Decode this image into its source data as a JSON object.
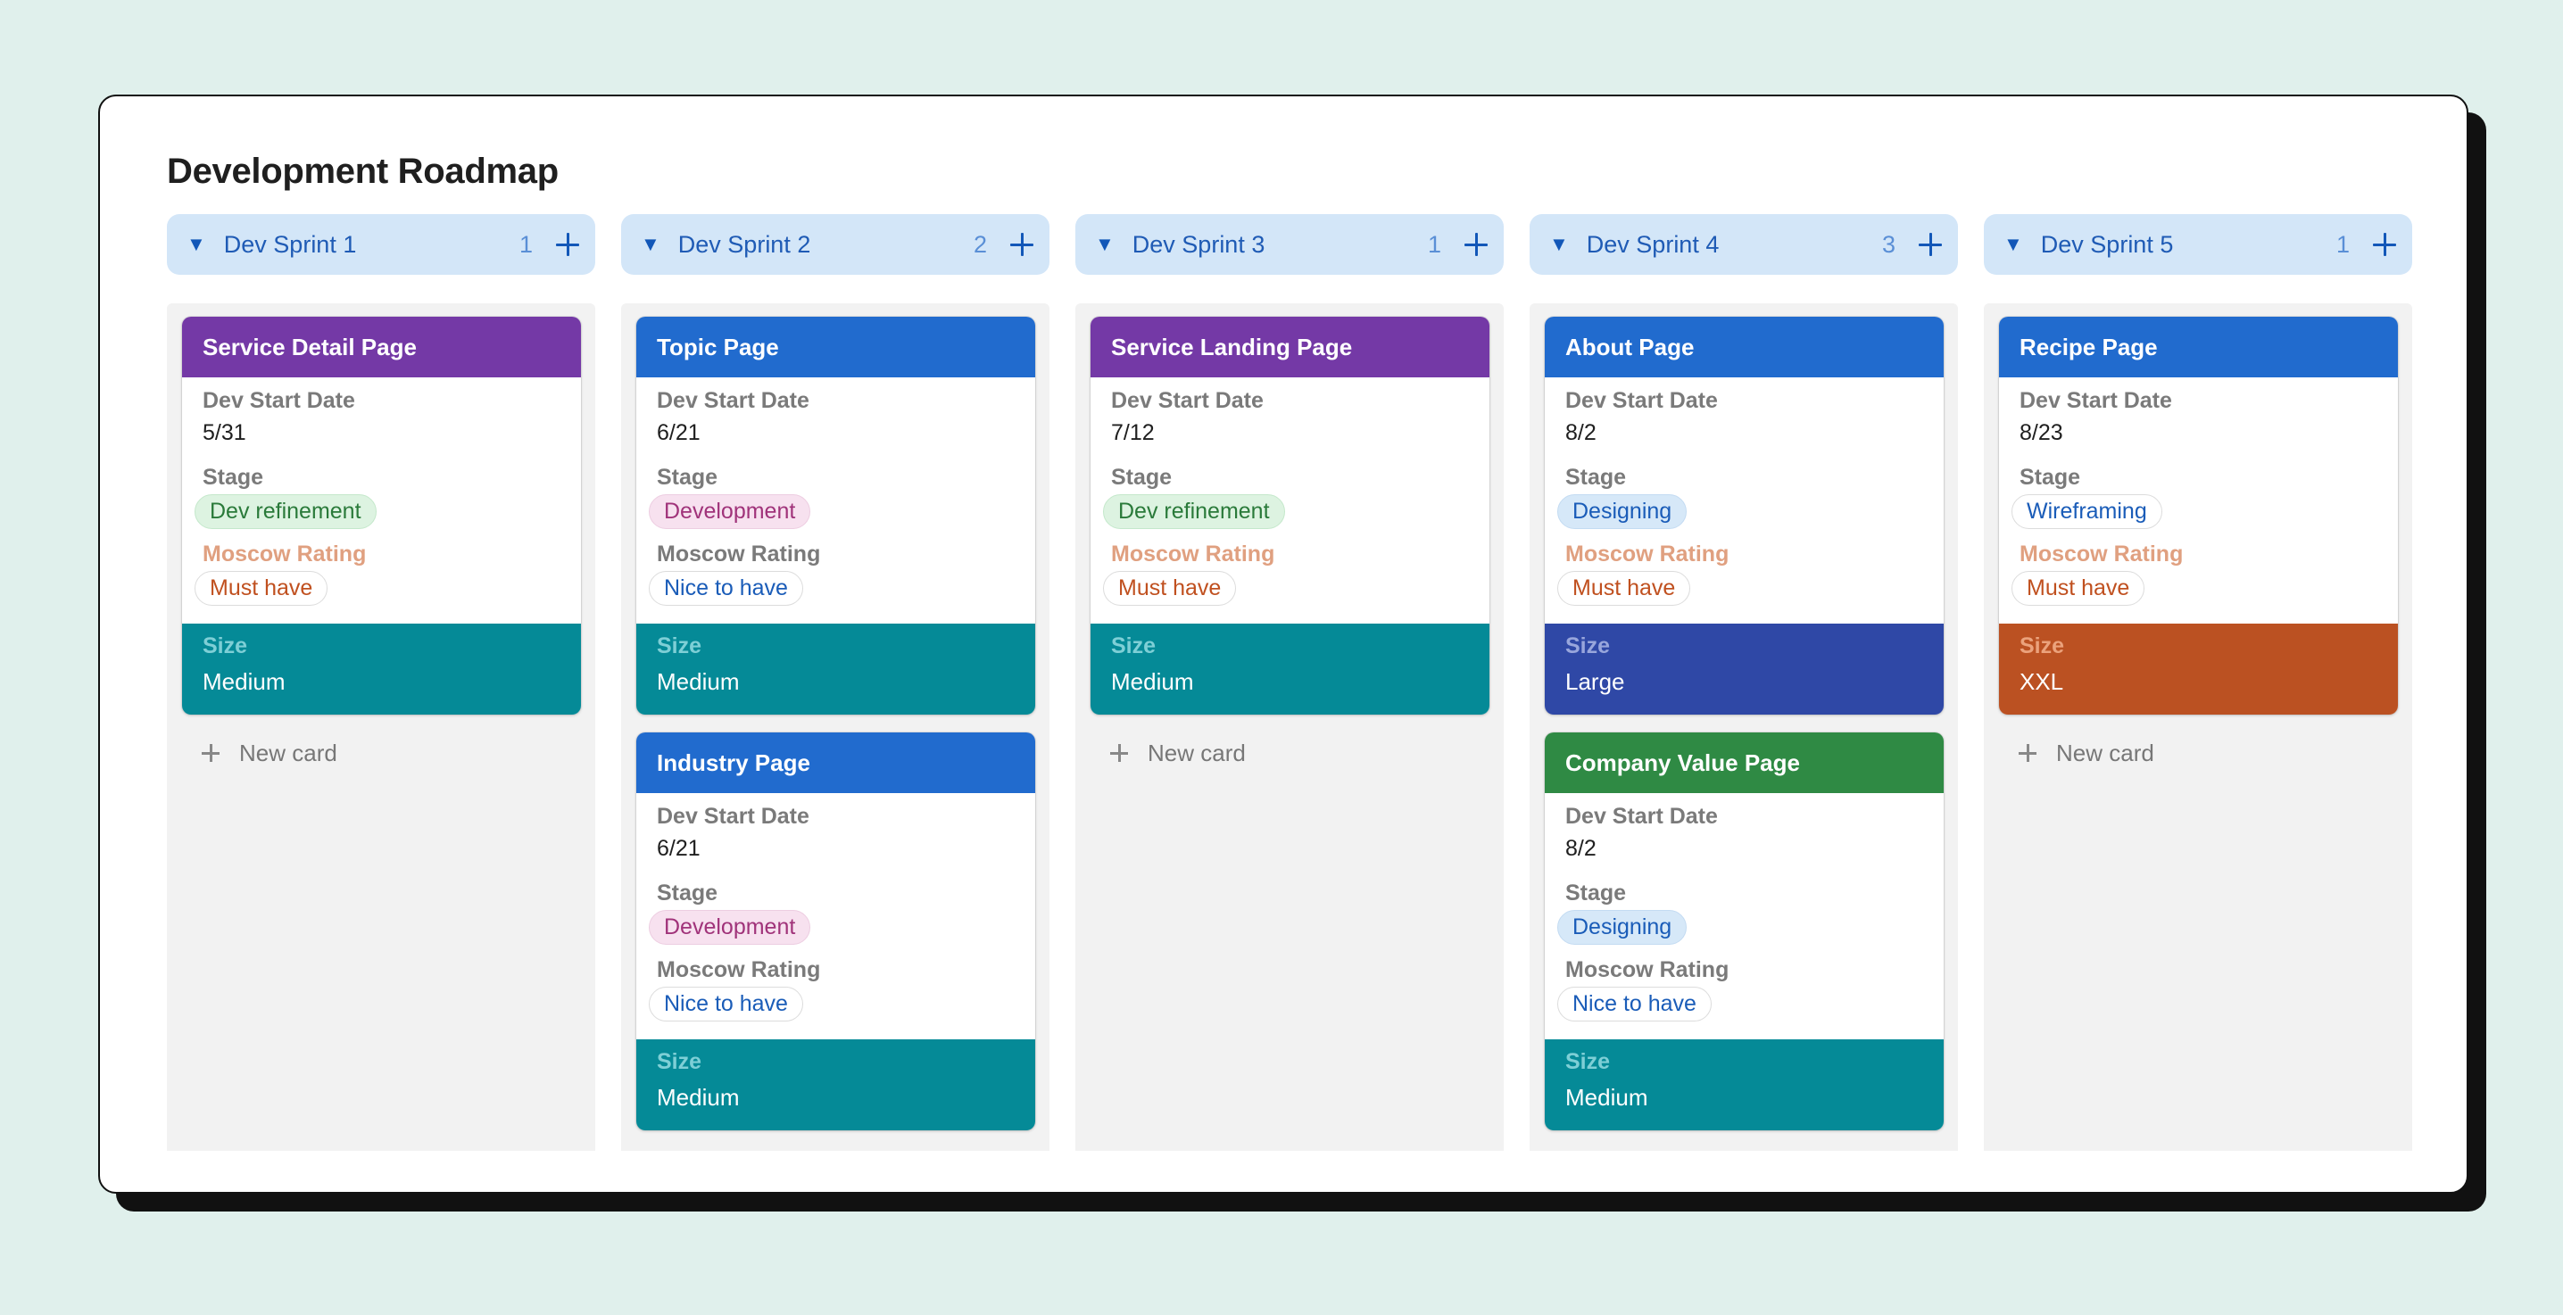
{
  "page": {
    "title": "Development Roadmap"
  },
  "labels": {
    "dev_start_date": "Dev Start Date",
    "stage": "Stage",
    "moscow_rating": "Moscow Rating",
    "size": "Size",
    "new_card": "New card"
  },
  "colors": {
    "background": "#e0f0ec",
    "column_header_bg": "#d3e6f8",
    "column_body_bg": "#f2f2f2",
    "title_purple": "#7439a6",
    "title_blue": "#216bce",
    "title_green": "#2f8a44",
    "size_teal": "#058a97",
    "size_indigo": "#2f48a6",
    "size_orange": "#bb5122",
    "moscow_label_must": "#e0a080",
    "moscow_label_default": "#7a7a7a"
  },
  "stages": {
    "Dev refinement": {
      "bg": "#ddf3e1",
      "fg": "#2a7a3a",
      "border": "#c4e8cb"
    },
    "Development": {
      "bg": "#f7e1ef",
      "fg": "#a0337a",
      "border": "#edcde1"
    },
    "Designing": {
      "bg": "#d6e8f8",
      "fg": "#1a5cb8",
      "border": "#c3dbf2"
    },
    "Wireframing": {
      "bg": "#ffffff",
      "fg": "#1a5cb8",
      "border": "#dcdcdc"
    }
  },
  "ratings": {
    "Must have": {
      "fg": "#c0501f"
    },
    "Nice to have": {
      "fg": "#1a5cb8"
    }
  },
  "columns": [
    {
      "name": "Dev Sprint 1",
      "count": "1",
      "cards": [
        {
          "title": "Service Detail Page",
          "title_color": "#7439a6",
          "date": "5/31",
          "stage": "Dev refinement",
          "rating": "Must have",
          "size": "Medium",
          "size_color": "#058a97",
          "size_label_color": "#7ecfd6"
        }
      ]
    },
    {
      "name": "Dev Sprint 2",
      "count": "2",
      "cards": [
        {
          "title": "Topic Page",
          "title_color": "#216bce",
          "date": "6/21",
          "stage": "Development",
          "rating": "Nice to have",
          "size": "Medium",
          "size_color": "#058a97",
          "size_label_color": "#7ecfd6"
        },
        {
          "title": "Industry Page",
          "title_color": "#216bce",
          "date": "6/21",
          "stage": "Development",
          "rating": "Nice to have",
          "size": "Medium",
          "size_color": "#058a97",
          "size_label_color": "#7ecfd6"
        }
      ]
    },
    {
      "name": "Dev Sprint 3",
      "count": "1",
      "cards": [
        {
          "title": "Service Landing Page",
          "title_color": "#7439a6",
          "date": "7/12",
          "stage": "Dev refinement",
          "rating": "Must have",
          "size": "Medium",
          "size_color": "#058a97",
          "size_label_color": "#7ecfd6"
        }
      ]
    },
    {
      "name": "Dev Sprint 4",
      "count": "3",
      "cards": [
        {
          "title": "About Page",
          "title_color": "#216bce",
          "date": "8/2",
          "stage": "Designing",
          "rating": "Must have",
          "size": "Large",
          "size_color": "#2f48a6",
          "size_label_color": "#98a6dc"
        },
        {
          "title": "Company Value Page",
          "title_color": "#2f8a44",
          "date": "8/2",
          "stage": "Designing",
          "rating": "Nice to have",
          "size": "Medium",
          "size_color": "#058a97",
          "size_label_color": "#7ecfd6"
        }
      ]
    },
    {
      "name": "Dev Sprint 5",
      "count": "1",
      "cards": [
        {
          "title": "Recipe Page",
          "title_color": "#216bce",
          "date": "8/23",
          "stage": "Wireframing",
          "rating": "Must have",
          "size": "XXL",
          "size_color": "#bb5122",
          "size_label_color": "#eba27c"
        }
      ]
    }
  ]
}
